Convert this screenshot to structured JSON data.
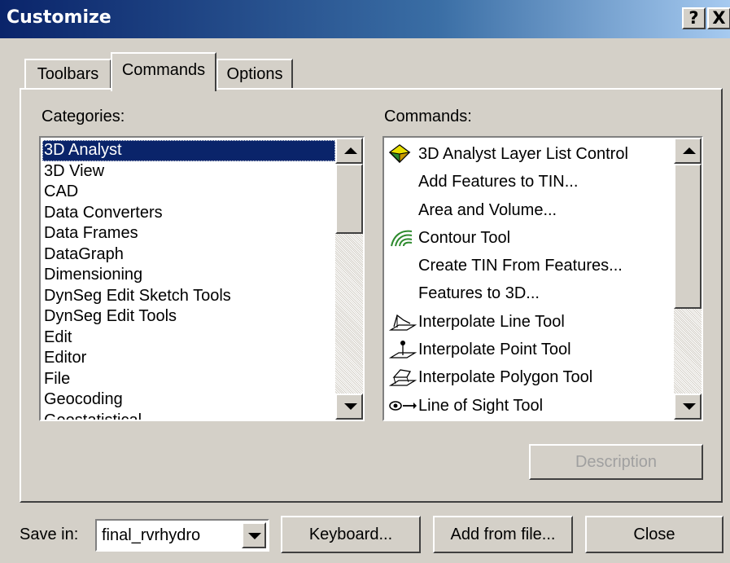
{
  "window": {
    "title": "Customize",
    "help_label": "?",
    "close_label": "X"
  },
  "tabs": [
    {
      "label": "Toolbars",
      "selected": false
    },
    {
      "label": "Commands",
      "selected": true
    },
    {
      "label": "Options",
      "selected": false
    }
  ],
  "categories": {
    "label": "Categories:",
    "selected": "3D Analyst",
    "items": [
      "3D Analyst",
      "3D View",
      "CAD",
      "Data Converters",
      "Data Frames",
      "DataGraph",
      "Dimensioning",
      "DynSeg Edit Sketch Tools",
      "DynSeg Edit Tools",
      "Edit",
      "Editor",
      "File",
      "Geocoding",
      "Geostatistical"
    ]
  },
  "commands": {
    "label": "Commands:",
    "items": [
      {
        "label": "3D Analyst Layer List Control",
        "icon": "diamond-layer-icon"
      },
      {
        "label": "Add Features to TIN...",
        "icon": ""
      },
      {
        "label": "Area and Volume...",
        "icon": ""
      },
      {
        "label": "Contour Tool",
        "icon": "contour-icon"
      },
      {
        "label": "Create TIN From Features...",
        "icon": ""
      },
      {
        "label": "Features to 3D...",
        "icon": ""
      },
      {
        "label": "Interpolate Line Tool",
        "icon": "interpolate-line-icon"
      },
      {
        "label": "Interpolate Point Tool",
        "icon": "interpolate-point-icon"
      },
      {
        "label": "Interpolate Polygon Tool",
        "icon": "interpolate-polygon-icon"
      },
      {
        "label": "Line of Sight Tool",
        "icon": "line-of-sight-icon"
      }
    ]
  },
  "buttons": {
    "description": "Description",
    "keyboard": "Keyboard...",
    "add_from_file": "Add from file...",
    "close": "Close"
  },
  "save_in": {
    "label": "Save in:",
    "value": "final_rvrhydro"
  },
  "colors": {
    "selection": "#0a246a",
    "dialog_face": "#d4d0c8",
    "title_gradient_start": "#0a246a",
    "title_gradient_end": "#a6caf0"
  }
}
